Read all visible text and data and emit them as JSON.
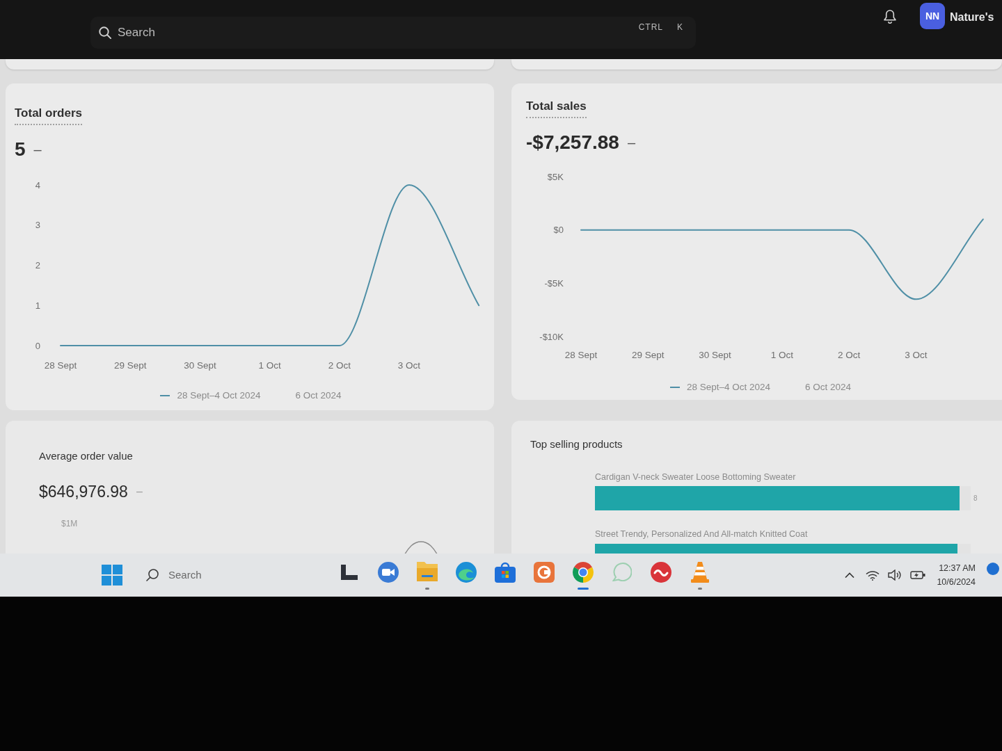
{
  "top_bar": {
    "search": {
      "placeholder": "Search",
      "shortcut_keys": [
        "CTRL",
        "K"
      ]
    },
    "account": {
      "initials": "NN",
      "name": "Nature's"
    }
  },
  "metric_cards": [
    {
      "title": "Total orders",
      "value": "5",
      "change": "–",
      "chart_data": {
        "type": "line",
        "categories": [
          "28 Sept",
          "29 Sept",
          "30 Sept",
          "1 Oct",
          "2 Oct",
          "3 Oct",
          null
        ],
        "values": [
          0,
          0,
          0,
          0,
          0,
          4,
          1
        ],
        "color": "#4f8fa6",
        "yticks": [
          0,
          1,
          2,
          3,
          4
        ],
        "ylim": [
          0,
          4
        ]
      },
      "legend": [
        {
          "label": "28 Sept–4 Oct 2024",
          "kind": "line"
        },
        {
          "label": "6 Oct 2024",
          "kind": "plain"
        }
      ]
    },
    {
      "title": "Total sales",
      "value": "-$7,257.88",
      "change": "–",
      "chart_data": {
        "type": "line",
        "categories": [
          "28 Sept",
          "29 Sept",
          "30 Sept",
          "1 Oct",
          "2 Oct",
          "3 Oct",
          null
        ],
        "values": [
          0,
          0,
          0,
          0,
          0,
          -6500,
          1000
        ],
        "color": "#4f8fa6",
        "yticks": [
          {
            "value": 5000,
            "label": "$5K"
          },
          {
            "value": 0,
            "label": "$0"
          },
          {
            "value": -5000,
            "label": "-$5K"
          },
          {
            "value": -10000,
            "label": "-$10K"
          }
        ],
        "ylim": [
          -10000,
          5000
        ]
      },
      "legend": [
        {
          "label": "28 Sept–4 Oct 2024",
          "kind": "line"
        },
        {
          "label": "6 Oct 2024",
          "kind": "plain"
        }
      ]
    }
  ],
  "average_order_value": {
    "title": "Average order value",
    "value": "$646,976.98",
    "change": "–",
    "axis_label": "$1M"
  },
  "top_selling_products": {
    "title": "Top selling products",
    "items": [
      {
        "name": "Cardigan V-neck Sweater Loose Bottoming Sweater",
        "value": "8",
        "level": 0.97
      },
      {
        "name": "Street Trendy, Personalized And All-match Knitted Coat",
        "level": 0.965
      }
    ]
  },
  "taskbar": {
    "search": {
      "placeholder": "Search"
    },
    "apps": [
      {
        "kind": "l-shape",
        "running": false,
        "selected": false
      },
      {
        "kind": "video-chat",
        "running": false,
        "selected": false
      },
      {
        "kind": "folder",
        "running": true,
        "selected": false
      },
      {
        "kind": "swirl",
        "running": false,
        "selected": false
      },
      {
        "kind": "bag",
        "running": false,
        "selected": false
      },
      {
        "kind": "tile",
        "running": false,
        "selected": false
      },
      {
        "kind": "color-wheel",
        "running": true,
        "selected": true
      },
      {
        "kind": "chat-bubble",
        "running": false,
        "selected": false
      },
      {
        "kind": "wave-badge",
        "running": false,
        "selected": false
      },
      {
        "kind": "cone",
        "running": true,
        "selected": false
      }
    ],
    "clock": {
      "time": "12:37 AM",
      "date": "10/6/2024"
    }
  }
}
